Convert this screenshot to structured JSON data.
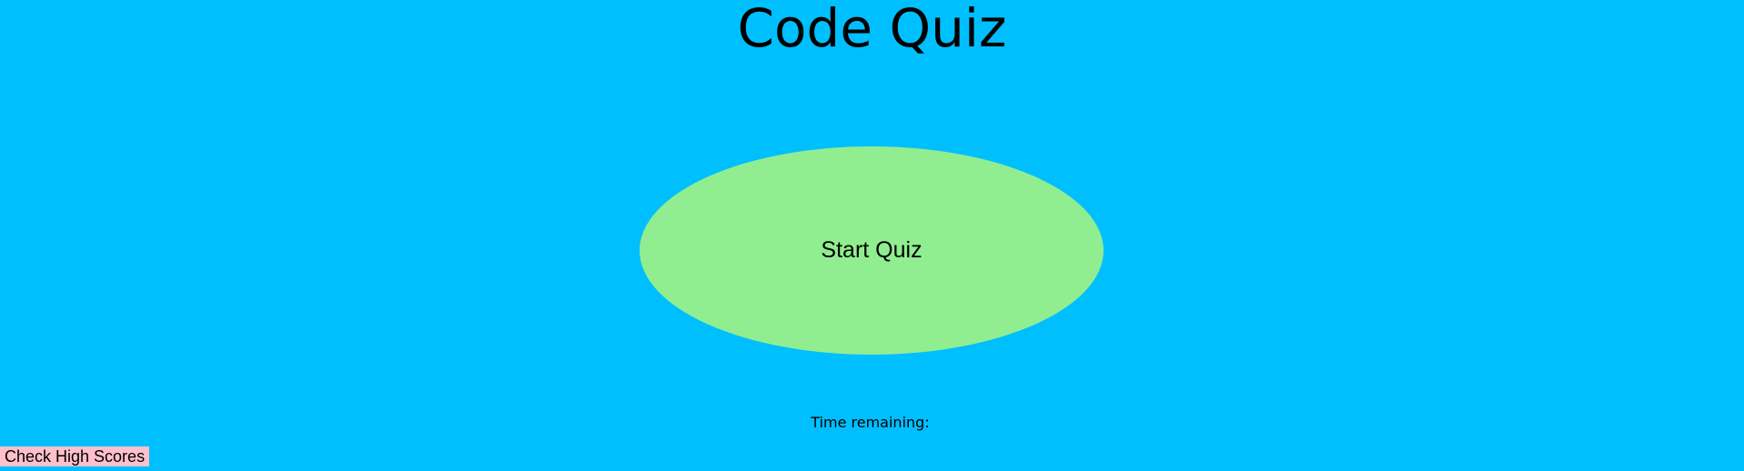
{
  "page": {
    "title": "Code Quiz",
    "background_color": "#00bfff"
  },
  "start_button": {
    "label": "Start Quiz",
    "color": "#90ee90"
  },
  "timer": {
    "label": "Time remaining:",
    "value": ""
  },
  "high_scores_button": {
    "label": "Check High Scores",
    "color": "#ffc0cb"
  }
}
